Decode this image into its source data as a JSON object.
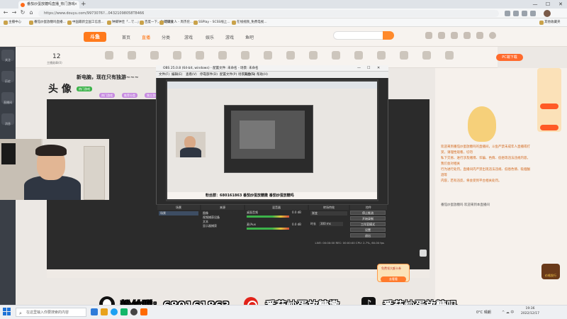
{
  "browser": {
    "tab_title": "番茄炒蛋放糖吗直播_热门游戏",
    "tab_close": "×",
    "new_tab": "+",
    "url": "https://www.douyu.com/9973076?...04321098058T8466",
    "win_minimize": "—",
    "win_maximize": "☐",
    "win_close": "✕",
    "back": "←",
    "forward": "→",
    "refresh": "↻",
    "home": "⌂"
  },
  "bookmarks": [
    "主播中心",
    "番茄炒蛋放糖吗直播...",
    "中国最新全国工信息...",
    "钟卿钟佳「...で...」",
    "百度一下，你就知道",
    "可爱女人 - 周杰伦...",
    "SSPlay - SCSS线上...",
    "在线视频_免费电视..."
  ],
  "bookmarks_right": "其他收藏夹",
  "site": {
    "logo": "斗鱼",
    "nav": [
      "首页",
      "直播",
      "分类",
      "游戏",
      "娱乐",
      "游戏",
      "鱼吧"
    ],
    "pc_button": "PC端下载",
    "sidebar_labels": [
      "关注",
      "历史",
      "直播间",
      "消息",
      "主页"
    ],
    "subscriber_count": "12",
    "subscriber_label": "主播勋章(0)",
    "room_title": "新电脑，现在只有独游~~~",
    "category_badges": [
      "热门游戏",
      "热门游戏",
      "推荐分类",
      "独立游戏"
    ],
    "streamer_name": "头 像",
    "chat_lines": [
      "欢迎来到番茄炒蛋放糖吗的直播间，斗鱼严禁未成年人直播或打赏，请理性观看，切勿",
      "私下交易、进行涉及赌博、诈骗、色情、低俗等违法违规内容，我们会对相关",
      "行为进行处罚。直播间内严禁出现违法违规、低俗色情、吸烟酗酒等",
      "内容，若有违反，将会受到平台相关处罚。"
    ],
    "welcome": "番茄炒蛋放糖吗 欢迎来到本直播间",
    "chest_label": "免费领大额卡券",
    "chest_button": "去看看",
    "gift_label": "价格发行"
  },
  "obs": {
    "title": "OBS 25.0.8 (64-bit, windows) - 配置文件: 未命名 - 场景: 未命名",
    "menu": [
      "文件(F)",
      "编辑(E)",
      "查看(V)",
      "停靠部件(D)",
      "配置文件(P)",
      "场景集合(S)",
      "工具(T)",
      "帮助(H)"
    ],
    "docks": [
      "场景",
      "来源",
      "混音器",
      "转场特效",
      "控件"
    ],
    "scene": "场景",
    "sources": [
      "图像",
      "视频捕获设备",
      "文本",
      "显示器捕获"
    ],
    "mixer": [
      "桌面音频",
      "麦/Aux",
      "视频捕获设备"
    ],
    "mixer_levels": [
      "0.0 dB",
      "0.0 dB",
      "0.0 dB"
    ],
    "transition": "渐变",
    "transition_duration_label": "时长",
    "transition_duration": "300 ms",
    "controls": [
      "停止推流",
      "开始录制",
      "工作室模式",
      "设置",
      "退出"
    ],
    "status": "LIVE: 00:00:00   REC: 00:00:00   CPU: 2.7%, 60.00 fps",
    "nested_overlay": "粉丝群：680161863  番茄炒蛋放糖撒  番茄炒蛋放糖吗"
  },
  "overlay": {
    "fan_group": "粉丝群：680161863",
    "handle_weibo": "番茄炒蛋放糖撒",
    "handle_douyin": "番茄炒蛋放糖吗",
    "tiktok_glyph": "♪"
  },
  "taskbar": {
    "search_placeholder": "在这里输入你要搜索的内容",
    "search_icon": "⌕",
    "weather": "0°C 晴朗",
    "tray": "^ ☁ 中",
    "time": "19:36",
    "date": "2022/12/17"
  },
  "colors": {
    "accent": "#ff7a1c",
    "obs_bg": "#2b2b2b",
    "weibo": "#e2231a"
  }
}
